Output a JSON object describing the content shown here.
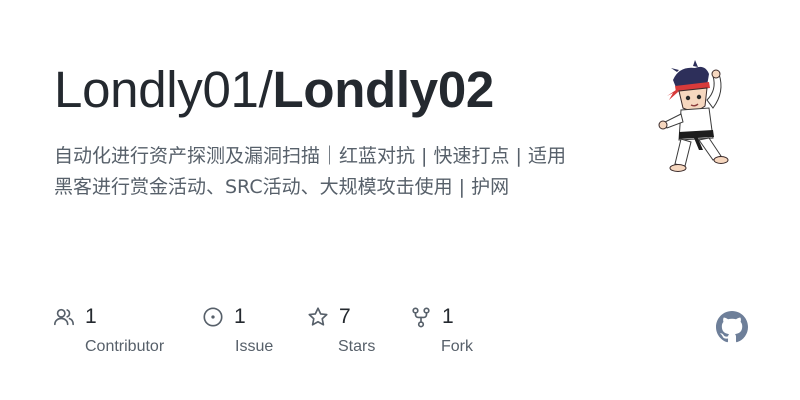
{
  "repo": {
    "owner": "Londly01/",
    "name": "Londly02",
    "description": "自动化进行资产探测及漏洞扫描｜红蓝对抗 | 快速打点 | 适用黑客进行赏金活动、SRC活动、大规模攻击使用 | 护网"
  },
  "stats": {
    "contributors": {
      "count": "1",
      "label": "Contributor",
      "icon": "people-icon"
    },
    "issues": {
      "count": "1",
      "label": "Issue",
      "icon": "issue-opened-icon"
    },
    "stars": {
      "count": "7",
      "label": "Stars",
      "icon": "star-icon"
    },
    "forks": {
      "count": "1",
      "label": "Fork",
      "icon": "repo-forked-icon"
    }
  },
  "colors": {
    "text_primary": "#24292f",
    "text_secondary": "#57606a",
    "icon": "#57606a",
    "github_logo": "#6e7f99"
  }
}
